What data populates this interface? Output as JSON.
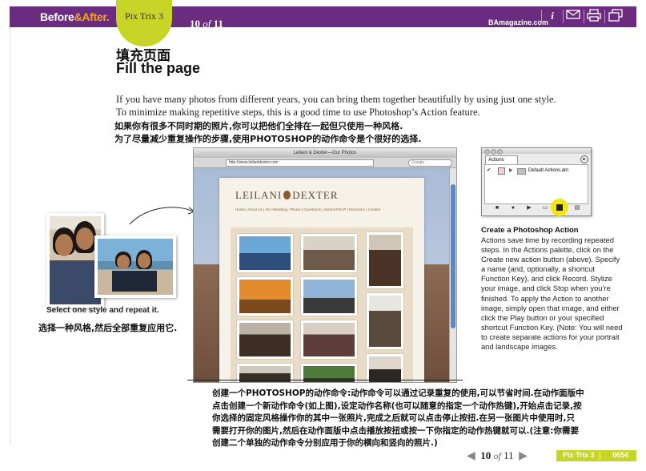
{
  "header": {
    "logo_before": "Before",
    "logo_amp": "&",
    "logo_after": "After",
    "logo_dot": ".",
    "section_tab": "Pix Trix 3",
    "page_current": "10",
    "page_of": "of",
    "page_total": "11",
    "site": "BAmagazine.com",
    "icons": [
      "info-icon",
      "email-icon",
      "print-icon",
      "window-icon"
    ],
    "colors": {
      "bar": "#6b2c80",
      "tab": "#c6d526",
      "accent": "#f2a81d"
    }
  },
  "title": {
    "cn": "填充页面",
    "en": "Fill the page"
  },
  "intro": {
    "en": "If you have many photos from different years, you can bring them together beautifully by using just one style. To minimize making repetitive steps, this is a good time to use Photoshop’s Action feature.",
    "cn_line1": "如果你有很多不同时期的照片,你可以把他们全排在一起但只使用一种风格.",
    "cn_line2": "为了尽量减少重复操作的步骤,使用PHOTOSHOP的动作命令是个很好的选择."
  },
  "browser": {
    "window_title": "Leilani & Dexter—Our Photos",
    "url": "http://www.leilanidexter.com",
    "search_placeholder": "Google",
    "brand_left": "LEILANI",
    "brand_right": "DEXTER",
    "nav": "Home | About Us | Our Wedding | Photos | Guestbook | Submit RSVP | Directions | Contact"
  },
  "left_caption": {
    "en": "Select one style and repeat it.",
    "cn": "选择一种风格,然后全部重复应用它."
  },
  "actions_panel": {
    "tab_label": "Actions",
    "item_label": "Default Actions.atn"
  },
  "right_caption": {
    "title": "Create a Photoshop Action",
    "body": "Actions save time by recording repeated steps. In the Actions palette, click on the Create new action button (above). Specify a name (and, optionally, a shortcut Function Key), and click Record. Stylize your image, and click Stop when you’re finished. To apply the Action to another image, simply open that image, and either click the Play button or your specified shortcut Function Key. (Note: You will need to create separate actions for your portrait and landscape images."
  },
  "bottom_cn": {
    "line1": "创建一个PHOTOSHOP的动作命令:动作命令可以通过记录重复的使用,可以节省时间.在动作面版中",
    "line2": "点击创建一个新动作命令(如上图),设定动作名称(也可以随意的指定一个动作热键),开始点击记录,按",
    "line3": "你选择的固定风格操作你的其中一张照片,完成之后就可以点击停止按扭.在另一张图片中使用时,只",
    "line4": "需要打开你的图片,然后在动作面版中点击播放按扭或按一下你指定的动作热键就可以.(注意:你需要",
    "line5": "创建二个单独的动作命令分别应用于你的横向和竖向的照片.)"
  },
  "footer": {
    "page_current": "10",
    "page_of": "of",
    "page_total": "11",
    "section": "Pix Trix 3",
    "page_code": "0654"
  }
}
